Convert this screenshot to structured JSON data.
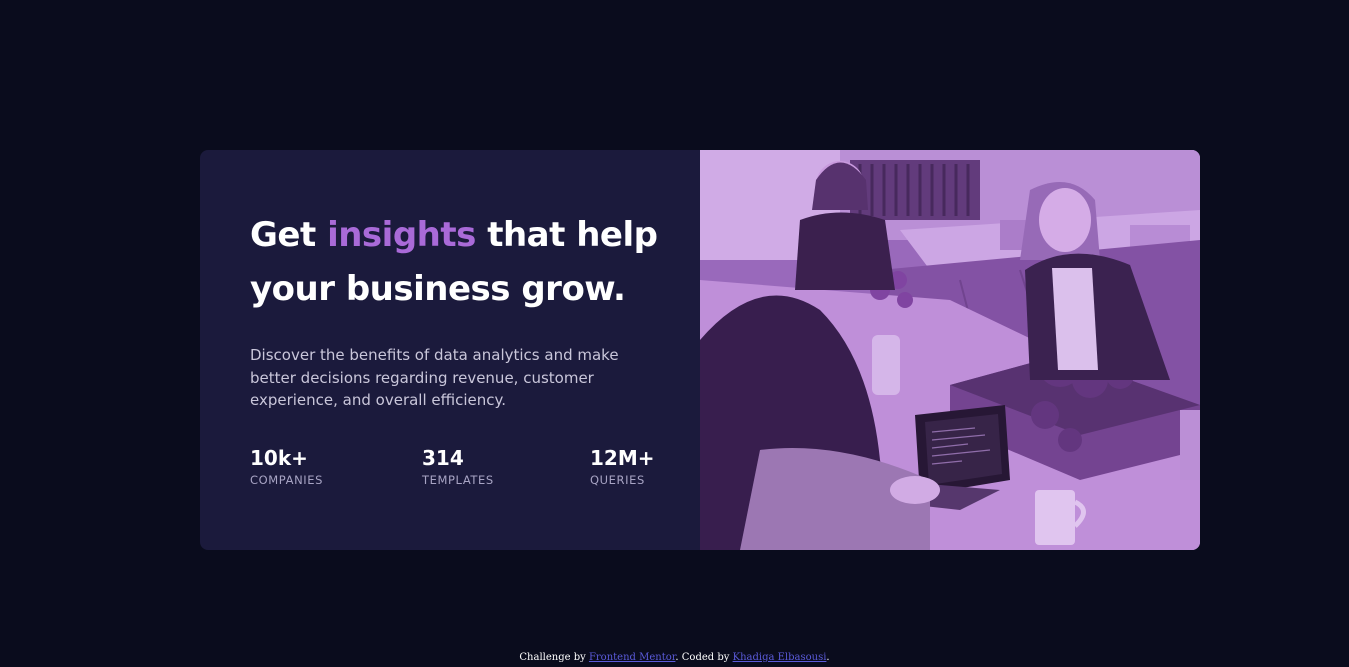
{
  "hero": {
    "headline_before": "Get ",
    "headline_accent": "insights",
    "headline_after": " that help your business grow.",
    "description": "Discover the benefits of data analytics and make better decisions regarding revenue, customer experience, and overall efficiency."
  },
  "stats": [
    {
      "value": "10k+",
      "label": "COMPANIES"
    },
    {
      "value": "314",
      "label": "TEMPLATES"
    },
    {
      "value": "12M+",
      "label": "QUERIES"
    }
  ],
  "footer": {
    "prefix": "Challenge by ",
    "link1": "Frontend Mentor",
    "middle": ". Coded by ",
    "link2": "Khadiga Elbasousi",
    "suffix": "."
  },
  "colors": {
    "page_background": "#0a0c1d",
    "card_background": "#1b1a3c",
    "accent": "#a96ad8",
    "image_tint": "#8c5aa6"
  }
}
